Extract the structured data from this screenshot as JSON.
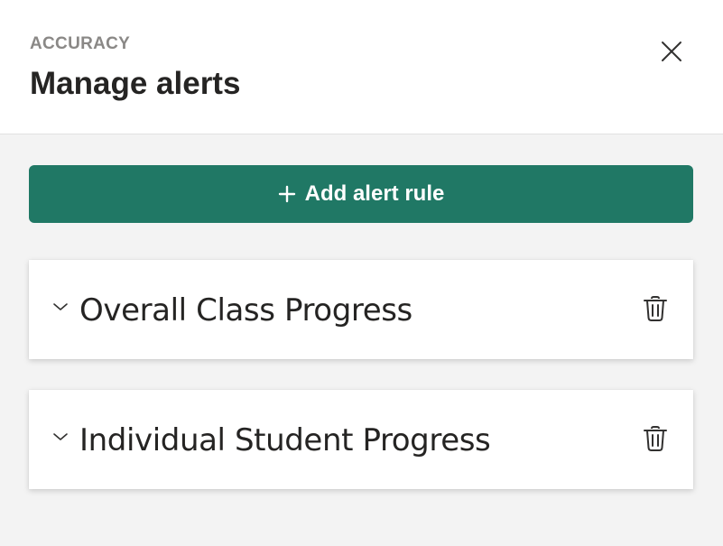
{
  "header": {
    "eyebrow": "ACCURACY",
    "title": "Manage alerts",
    "close_icon": "close-icon"
  },
  "actions": {
    "add_label": "Add alert rule",
    "add_icon": "plus-icon",
    "accent_color": "#207865"
  },
  "rules": [
    {
      "name": "Overall Class Progress",
      "expand_icon": "chevron-down-icon",
      "delete_icon": "trash-icon"
    },
    {
      "name": "Individual Student Progress",
      "expand_icon": "chevron-down-icon",
      "delete_icon": "trash-icon"
    }
  ]
}
